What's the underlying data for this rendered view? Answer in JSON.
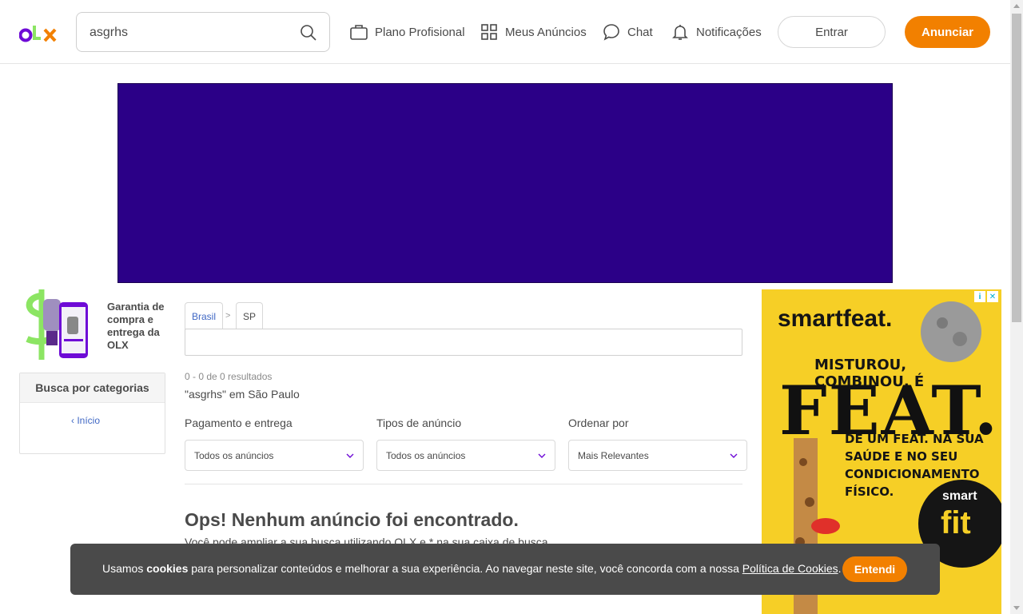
{
  "header": {
    "logo_text": "OLX",
    "search": {
      "value": "asgrhs",
      "placeholder": ""
    },
    "nav": [
      {
        "label": "Plano Profisional",
        "icon": "briefcase-icon"
      },
      {
        "label": "Meus Anúncios",
        "icon": "grid-icon"
      },
      {
        "label": "Chat",
        "icon": "chat-bubble-icon"
      },
      {
        "label": "Notificações",
        "icon": "bell-icon"
      }
    ],
    "login_label": "Entrar",
    "post_label": "Anunciar"
  },
  "colors": {
    "accent": "#f28000",
    "banner": "#2b0087",
    "link": "#3f67c4",
    "cookie_bg": "#4a4a4a",
    "ad_bg": "#f6cf26"
  },
  "sidebar": {
    "garantia": "Garantia de compra e entrega da OLX",
    "categories_title": "Busca por categorias",
    "inicio_label": "Início"
  },
  "breadcrumb": {
    "items": [
      "Brasil",
      "SP"
    ],
    "separator": ">"
  },
  "location_input": {
    "value": ""
  },
  "results": {
    "count_text": "0 - 0 de 0 resultados",
    "query_text": "\"asgrhs\" em São Paulo"
  },
  "filters": [
    {
      "label": "Pagamento e entrega",
      "selected": "Todos os anúncios"
    },
    {
      "label": "Tipos de anúncio",
      "selected": "Todos os anúncios"
    },
    {
      "label": "Ordenar por",
      "selected": "Mais Relevantes"
    }
  ],
  "empty": {
    "title": "Ops! Nenhum anúncio foi encontrado.",
    "subtitle": "Você pode ampliar a sua busca utilizando OLX e * na sua caixa de busca."
  },
  "ad": {
    "brand": "smartfeat.",
    "line1": "MISTUROU, COMBINOU, É",
    "headline": "FEAT.",
    "line2": "DÊ UM FEAT. NA SUA SAÚDE E NO SEU CONDICIONAMENTO FÍSICO.",
    "brand2_top": "smart",
    "brand2_bottom": "fit"
  },
  "cookie": {
    "pre": "Usamos ",
    "bold": "cookies",
    "mid": " para personalizar conteúdos e melhorar a sua experiência. Ao navegar neste site, você concorda com a nossa ",
    "link": "Política de Cookies",
    "post": ".",
    "button": "Entendi"
  }
}
